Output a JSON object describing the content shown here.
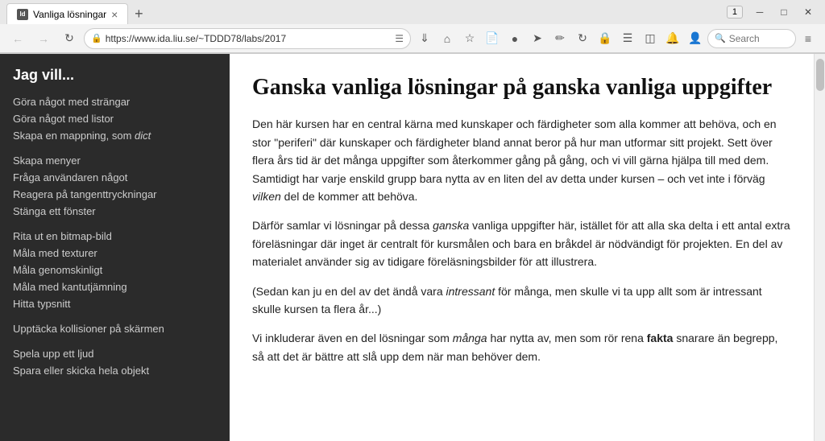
{
  "browser": {
    "tab": {
      "favicon": "ld",
      "label": "Vanliga lösningar",
      "close": "×"
    },
    "new_tab_label": "+",
    "tab_count": "1",
    "window_controls": {
      "minimize": "─",
      "maximize": "□",
      "close": "✕"
    },
    "address": {
      "back_disabled": true,
      "forward_disabled": true,
      "url": "https://www.ida.liu.se/~TDDD78/labs/2017",
      "search_placeholder": "Search"
    }
  },
  "sidebar": {
    "title": "Jag vill...",
    "items": [
      {
        "label": "Göra något med strängar",
        "italic": false
      },
      {
        "label": "Göra något med listor",
        "italic": false
      },
      {
        "label": "Skapa en mappning, som dict",
        "italic": true,
        "italic_word": "dict"
      },
      {
        "label": "",
        "divider": true
      },
      {
        "label": "Skapa menyer",
        "italic": false
      },
      {
        "label": "Fråga användaren något",
        "italic": false
      },
      {
        "label": "Reagera på tangenttryckningar",
        "italic": false
      },
      {
        "label": "Stänga ett fönster",
        "italic": false
      },
      {
        "label": "",
        "divider": true
      },
      {
        "label": "Rita ut en bitmap-bild",
        "italic": false
      },
      {
        "label": "Måla med texturer",
        "italic": false
      },
      {
        "label": "Måla genomskinligt",
        "italic": false
      },
      {
        "label": "Måla med kantutjämning",
        "italic": false
      },
      {
        "label": "Hitta typsnitt",
        "italic": false
      },
      {
        "label": "",
        "divider": true
      },
      {
        "label": "Upptäcka kollisioner på skärmen",
        "italic": false
      },
      {
        "label": "",
        "divider": true
      },
      {
        "label": "Spela upp ett ljud",
        "italic": false
      },
      {
        "label": "Spara eller skicka hela objekt",
        "italic": false
      }
    ]
  },
  "main": {
    "title": "Ganska vanliga lösningar på ganska vanliga uppgifter",
    "paragraphs": [
      {
        "id": "p1",
        "text": "Den här kursen har en central kärna med kunskaper och färdigheter som alla kommer att behöva, och en stor \"periferi\" där kunskaper och färdigheter bland annat beror på hur man utformar sitt projekt. Sett över flera års tid är det många uppgifter som återkommer gång på gång, och vi vill gärna hjälpa till med dem. Samtidigt har varje enskild grupp bara nytta av en liten del av detta under kursen – och vet inte i förväg ",
        "italic_part": "vilken",
        "text_after": " del de kommer att behöva."
      },
      {
        "id": "p2",
        "text_before": "Därför samlar vi lösningar på dessa ",
        "italic_part": "ganska",
        "text_after": " vanliga uppgifter här, istället för att alla ska delta i ett antal extra föreläsningar där inget är centralt för kursmålen och bara en bråkdel är nödvändigt för projekten. En del av materialet använder sig av tidigare föreläsningsbilder för att illustrera."
      },
      {
        "id": "p3",
        "text_before": "(Sedan kan ju en del av det ändå vara ",
        "italic_part": "intressant",
        "text_after": " för många, men skulle vi ta upp allt som är intressant skulle kursen ta flera år...)"
      },
      {
        "id": "p4",
        "text_before": "Vi inkluderar även en del lösningar som ",
        "italic_part": "många",
        "text_after": " har nytta av, men som rör rena ",
        "bold_part": "fakta",
        "text_final": " snarare än begrepp, så att det är bättre att slå upp dem när man behöver dem."
      }
    ]
  }
}
